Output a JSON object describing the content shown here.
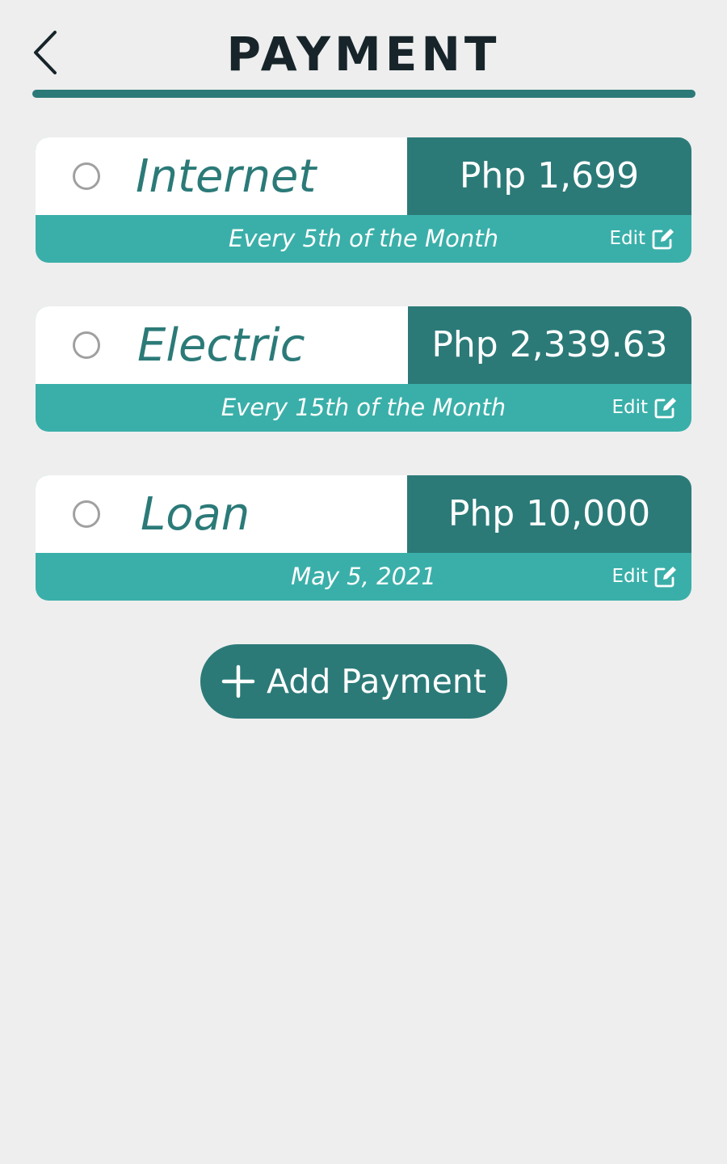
{
  "header": {
    "title": "PAYMENT",
    "back_icon": "chevron-left-icon"
  },
  "colors": {
    "background": "#eeeeee",
    "accent_dark": "#2b7a78",
    "accent_light": "#3aafa9",
    "title_text": "#17252a"
  },
  "payments": [
    {
      "name": "Internet",
      "amount": "Php 1,699",
      "schedule": "Every 5th of the Month",
      "edit_label": "Edit",
      "checked": false
    },
    {
      "name": "Electric",
      "amount": "Php 2,339.63",
      "schedule": "Every 15th of the Month",
      "edit_label": "Edit",
      "checked": false
    },
    {
      "name": "Loan",
      "amount": "Php 10,000",
      "schedule": "May 5, 2021",
      "edit_label": "Edit",
      "checked": false
    }
  ],
  "add_button": {
    "label": "Add Payment",
    "icon": "plus-icon"
  }
}
